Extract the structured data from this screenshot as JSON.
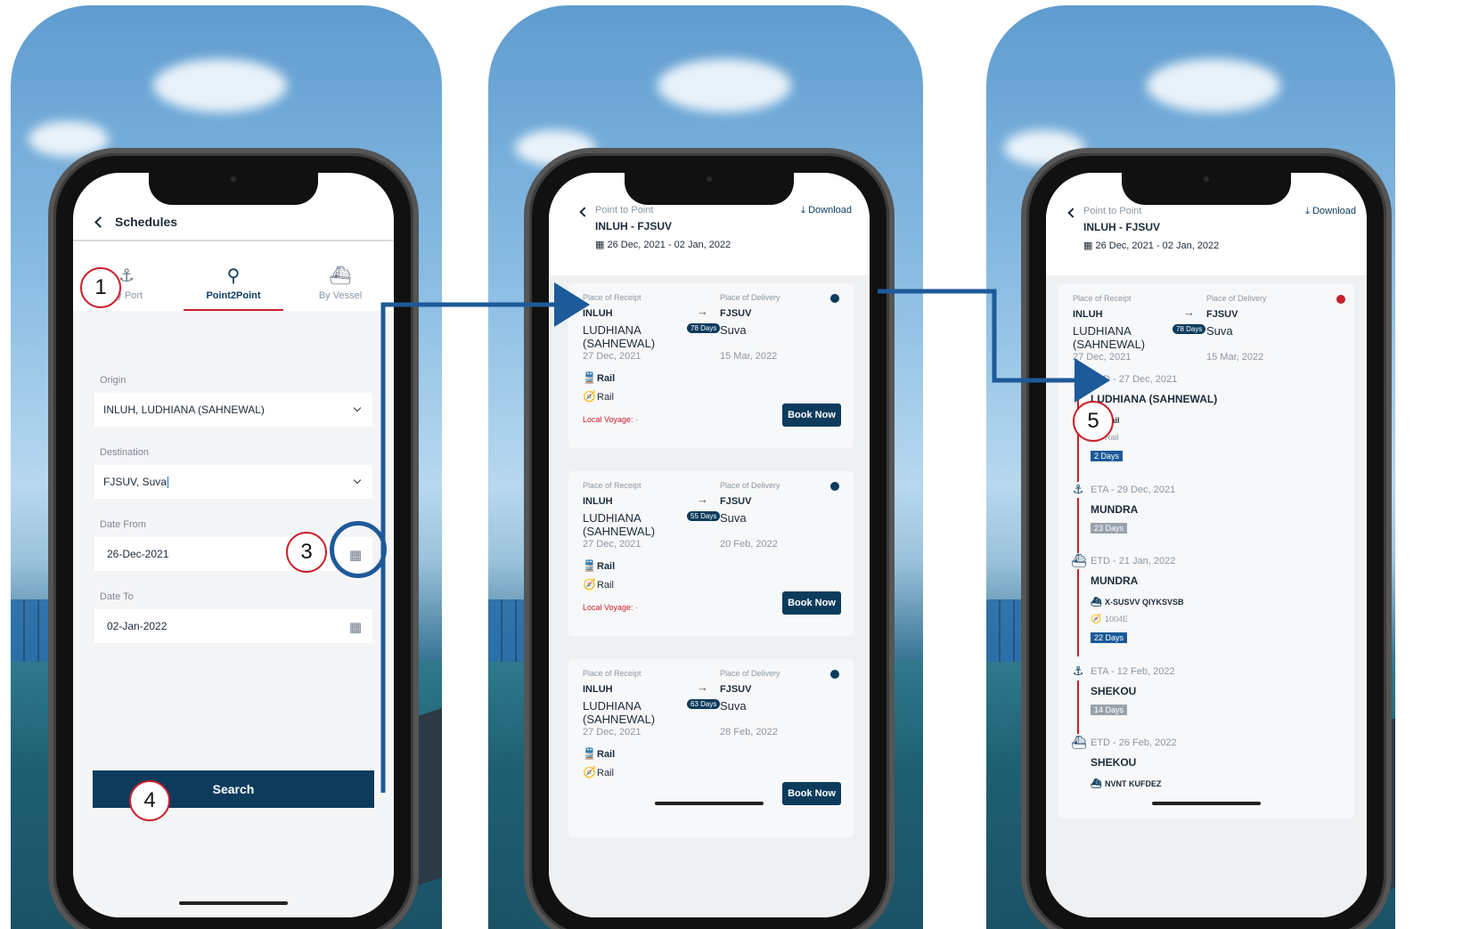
{
  "screen1": {
    "title": "Schedules",
    "tabs": [
      {
        "label": "By Port",
        "icon": "anchor-icon"
      },
      {
        "label": "Point2Point",
        "icon": "map-pins-icon"
      },
      {
        "label": "By Vessel",
        "icon": "ship-icon"
      }
    ],
    "active_tab": "Point2Point",
    "origin": {
      "label": "Origin",
      "value": "INLUH, LUDHIANA (SAHNEWAL)"
    },
    "destination": {
      "label": "Destination",
      "value": "FJSUV, Suva"
    },
    "date_from": {
      "label": "Date From",
      "value": "26-Dec-2021"
    },
    "date_to": {
      "label": "Date To",
      "value": "02-Jan-2022"
    },
    "search_label": "Search"
  },
  "screen2": {
    "breadcrumb": "Point to Point",
    "route": "INLUH - FJSUV",
    "date_range": "26 Dec, 2021 - 02 Jan, 2022",
    "download_label": "Download",
    "cards": [
      {
        "receipt_label": "Place of Receipt",
        "delivery_label": "Place of Delivery",
        "origin_code": "INLUH",
        "origin_name_1": "LUDHIANA",
        "origin_name_2": "(SAHNEWAL)",
        "origin_date": "27 Dec, 2021",
        "dest_code": "FJSUV",
        "dest_name": "Suva",
        "dest_date": "15 Mar, 2022",
        "days": "78 Days",
        "mode1": "Rail",
        "mode2": "Rail",
        "local_voyage_label": "Local Voyage:",
        "local_voyage_value": "-",
        "book_label": "Book Now"
      },
      {
        "receipt_label": "Place of Receipt",
        "delivery_label": "Place of Delivery",
        "origin_code": "INLUH",
        "origin_name_1": "LUDHIANA",
        "origin_name_2": "(SAHNEWAL)",
        "origin_date": "27 Dec, 2021",
        "dest_code": "FJSUV",
        "dest_name": "Suva",
        "dest_date": "20 Feb, 2022",
        "days": "55 Days",
        "mode1": "Rail",
        "mode2": "Rail",
        "local_voyage_label": "Local Voyage:",
        "local_voyage_value": "-",
        "book_label": "Book Now"
      },
      {
        "receipt_label": "Place of Receipt",
        "delivery_label": "Place of Delivery",
        "origin_code": "INLUH",
        "origin_name_1": "LUDHIANA",
        "origin_name_2": "(SAHNEWAL)",
        "origin_date": "27 Dec, 2021",
        "dest_code": "FJSUV",
        "dest_name": "Suva",
        "dest_date": "28 Feb, 2022",
        "days": "63 Days",
        "mode1": "Rail",
        "mode2": "Rail",
        "book_label": "Book Now"
      }
    ]
  },
  "screen3": {
    "breadcrumb": "Point to Point",
    "route": "INLUH - FJSUV",
    "date_range": "26 Dec, 2021 - 02 Jan, 2022",
    "download_label": "Download",
    "summary": {
      "receipt_label": "Place of Receipt",
      "delivery_label": "Place of Delivery",
      "origin_code": "INLUH",
      "origin_name_1": "LUDHIANA",
      "origin_name_2": "(SAHNEWAL)",
      "origin_date": "27 Dec, 2021",
      "dest_code": "FJSUV",
      "dest_name": "Suva",
      "dest_date": "15 Mar, 2022",
      "days": "78 Days"
    },
    "timeline": [
      {
        "icon": "train-icon",
        "event": "ETD - 27 Dec, 2021",
        "place": "LUDHIANA (SAHNEWAL)",
        "detail1": "Rail",
        "detail2": "Rail",
        "duration": "2 Days"
      },
      {
        "icon": "anchor-icon",
        "event": "ETA - 29 Dec, 2021",
        "place": "MUNDRA",
        "duration": "23 Days"
      },
      {
        "icon": "ship-icon",
        "event": "ETD - 21 Jan, 2022",
        "place": "MUNDRA",
        "detail1": "X-SUSVV QIYKSVSB",
        "detail2": "1004E",
        "duration": "22 Days"
      },
      {
        "icon": "anchor-icon",
        "event": "ETA - 12 Feb, 2022",
        "place": "SHEKOU",
        "duration": "14 Days"
      },
      {
        "icon": "ship-icon",
        "event": "ETD - 26 Feb, 2022",
        "place": "SHEKOU",
        "detail1": "NVNT KUFDEZ"
      }
    ]
  },
  "annotations": [
    "1",
    "3",
    "4",
    "5"
  ],
  "colors": {
    "primary": "#0c3b5c",
    "accent_red": "#c8202b",
    "annotation_blue": "#1d5a99"
  }
}
